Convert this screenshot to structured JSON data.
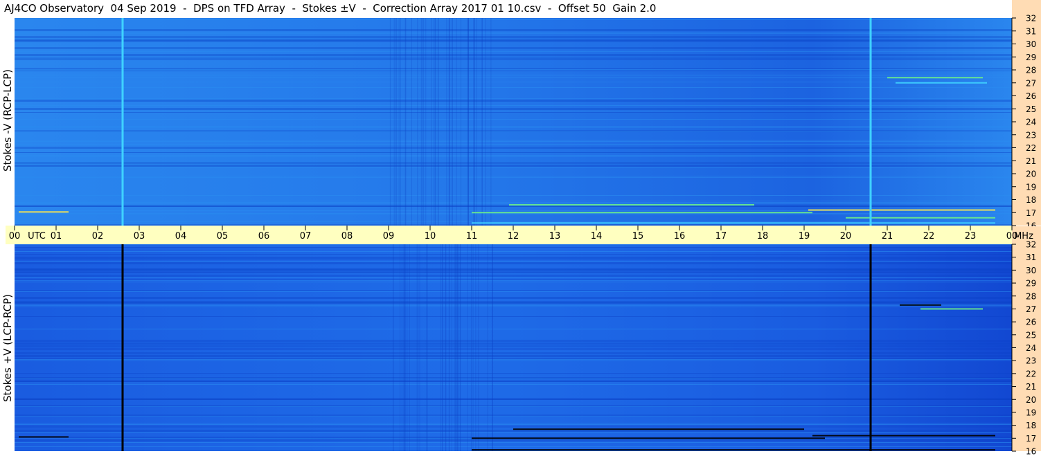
{
  "title": "AJ4CO Observatory  04 Sep 2019  -  DPS on TFD Array  -  Stokes ±V  -  Correction Array 2017 01 10.csv  -  Offset 50  Gain 2.0",
  "colors": {
    "background_blue": "#1f6fe8",
    "deep_blue": "#0a3fc4",
    "light_blue": "#2a8cf0",
    "cyan": "#3fd2ff",
    "green": "#6df08a",
    "yellow": "#ffe84a",
    "axis_band": "#ffffc0",
    "right_margin": "#ffdcb4"
  },
  "chart_data": [
    {
      "type": "heatmap",
      "panel": "top",
      "ylabel": "Stokes -V (RCP-LCP)",
      "x_unit": "UTC",
      "y_unit": "MHz",
      "xlim": [
        0,
        24
      ],
      "ylim": [
        16,
        32
      ],
      "x_tick_labels": [
        "00",
        "01",
        "02",
        "03",
        "04",
        "05",
        "06",
        "07",
        "08",
        "09",
        "10",
        "11",
        "12",
        "13",
        "14",
        "15",
        "16",
        "17",
        "18",
        "19",
        "20",
        "21",
        "22",
        "23",
        "00"
      ],
      "y_tick_labels": [
        "16",
        "17",
        "18",
        "19",
        "20",
        "21",
        "22",
        "23",
        "24",
        "25",
        "26",
        "27",
        "28",
        "29",
        "30",
        "31",
        "32"
      ],
      "vertical_lines": [
        {
          "utc": 2.6,
          "color": "cyan"
        },
        {
          "utc": 20.6,
          "color": "cyan"
        }
      ],
      "features": [
        {
          "utc_start": 0.1,
          "utc_end": 1.3,
          "mhz": 17.05,
          "color": "yellow"
        },
        {
          "utc_start": 11.0,
          "utc_end": 19.2,
          "mhz": 17.0,
          "color": "green"
        },
        {
          "utc_start": 11.9,
          "utc_end": 17.8,
          "mhz": 17.6,
          "color": "green"
        },
        {
          "utc_start": 19.1,
          "utc_end": 23.6,
          "mhz": 17.2,
          "color": "yellow"
        },
        {
          "utc_start": 20.0,
          "utc_end": 23.6,
          "mhz": 16.6,
          "color": "green"
        },
        {
          "utc_start": 21.0,
          "utc_end": 23.3,
          "mhz": 27.4,
          "color": "green"
        },
        {
          "utc_start": 21.2,
          "utc_end": 23.4,
          "mhz": 27.0,
          "color": "cyan"
        },
        {
          "utc_start": 11.0,
          "utc_end": 23.6,
          "mhz": 16.2,
          "color": "cyan"
        }
      ]
    },
    {
      "type": "heatmap",
      "panel": "bottom",
      "ylabel": "Stokes +V (LCP-RCP)",
      "x_unit": "UTC",
      "y_unit": "MHz",
      "xlim": [
        0,
        24
      ],
      "ylim": [
        16,
        32
      ],
      "x_tick_labels": [
        "00",
        "01",
        "02",
        "03",
        "04",
        "05",
        "06",
        "07",
        "08",
        "09",
        "10",
        "11",
        "12",
        "13",
        "14",
        "15",
        "16",
        "17",
        "18",
        "19",
        "20",
        "21",
        "22",
        "23",
        "00"
      ],
      "y_tick_labels": [
        "16",
        "17",
        "18",
        "19",
        "20",
        "21",
        "22",
        "23",
        "24",
        "25",
        "26",
        "27",
        "28",
        "29",
        "30",
        "31",
        "32"
      ],
      "vertical_lines": [
        {
          "utc": 2.6,
          "color": "black"
        },
        {
          "utc": 20.6,
          "color": "black"
        }
      ],
      "features": [
        {
          "utc_start": 0.1,
          "utc_end": 1.3,
          "mhz": 17.1,
          "color": "black"
        },
        {
          "utc_start": 11.0,
          "utc_end": 19.5,
          "mhz": 17.0,
          "color": "black"
        },
        {
          "utc_start": 12.0,
          "utc_end": 19.0,
          "mhz": 17.7,
          "color": "black"
        },
        {
          "utc_start": 19.2,
          "utc_end": 23.6,
          "mhz": 17.2,
          "color": "black"
        },
        {
          "utc_start": 21.8,
          "utc_end": 23.3,
          "mhz": 27.0,
          "color": "green"
        },
        {
          "utc_start": 21.3,
          "utc_end": 22.3,
          "mhz": 27.3,
          "color": "black"
        },
        {
          "utc_start": 11.0,
          "utc_end": 23.6,
          "mhz": 16.1,
          "color": "black"
        }
      ]
    }
  ]
}
